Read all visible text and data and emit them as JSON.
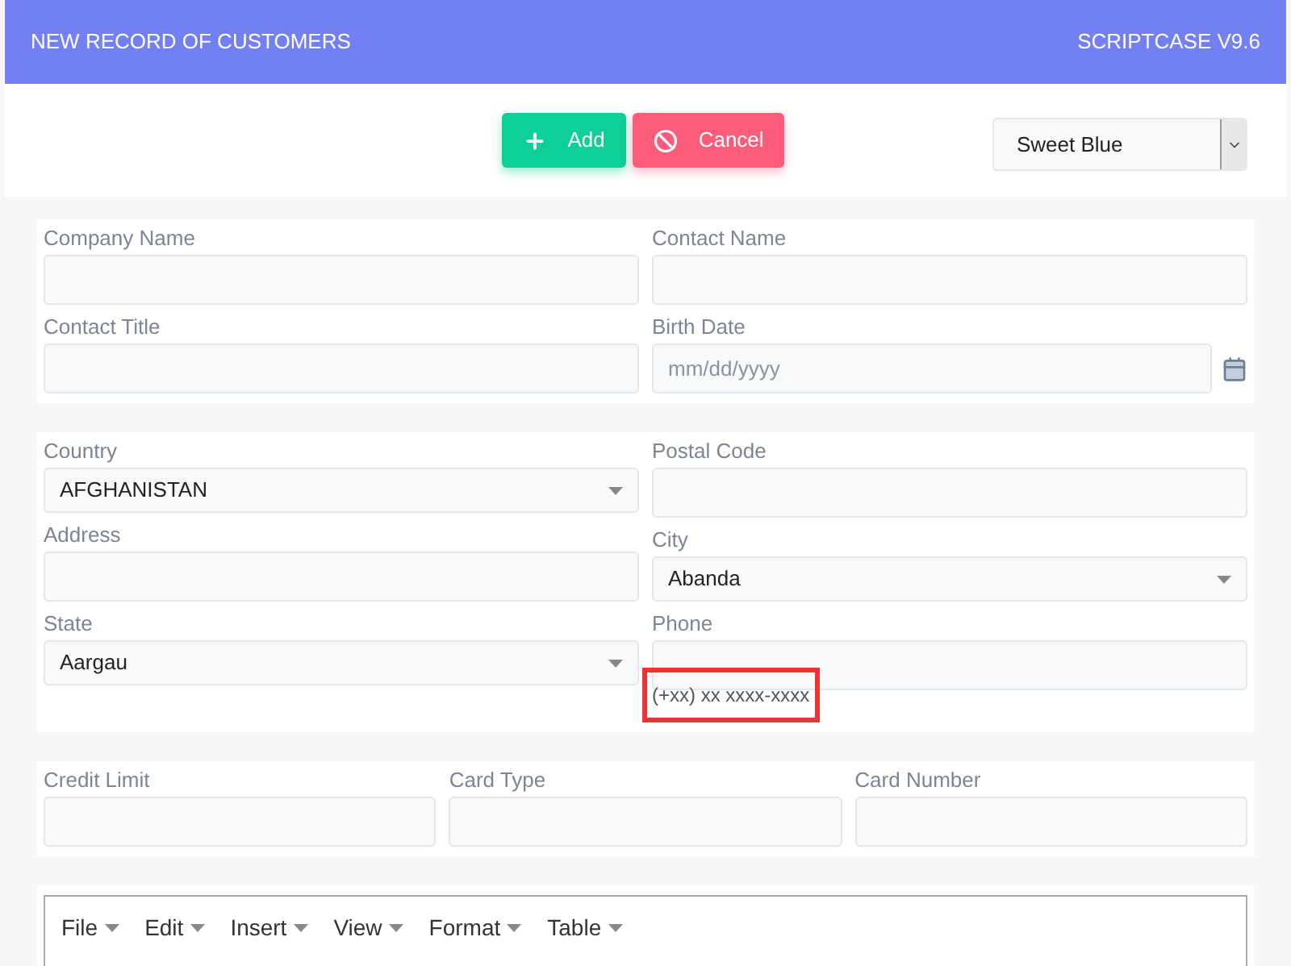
{
  "header": {
    "title": "NEW RECORD OF CUSTOMERS",
    "version": "SCRIPTCASE V9.6"
  },
  "toolbar": {
    "buttons": [
      {
        "kind": "add",
        "label": "Add"
      },
      {
        "kind": "cancel",
        "label": "Cancel"
      }
    ],
    "theme_select": {
      "value": "Sweet Blue"
    }
  },
  "sections": [
    {
      "columns": [
        [
          {
            "kind": "text",
            "label": "Company Name"
          },
          {
            "kind": "text",
            "label": "Contact Title"
          }
        ],
        [
          {
            "kind": "text",
            "label": "Contact Name"
          },
          {
            "kind": "date",
            "label": "Birth Date",
            "placeholder": "mm/dd/yyyy"
          }
        ]
      ]
    },
    {
      "columns": [
        [
          {
            "kind": "select",
            "label": "Country",
            "value": "AFGHANISTAN"
          },
          {
            "kind": "text",
            "label": "Address"
          },
          {
            "kind": "select",
            "label": "State",
            "value": "Aargau"
          }
        ],
        [
          {
            "kind": "text",
            "label": "Postal Code"
          },
          {
            "kind": "select",
            "label": "City",
            "value": "Abanda"
          },
          {
            "kind": "text",
            "label": "Phone",
            "hint": "(+xx) xx xxxx-xxxx"
          }
        ]
      ]
    },
    {
      "columns": [
        [
          {
            "kind": "text",
            "label": "Credit Limit"
          }
        ],
        [
          {
            "kind": "text",
            "label": "Card Type"
          }
        ],
        [
          {
            "kind": "text",
            "label": "Card Number"
          }
        ]
      ]
    }
  ],
  "editor": {
    "menu": [
      "File",
      "Edit",
      "Insert",
      "View",
      "Format",
      "Table"
    ]
  }
}
